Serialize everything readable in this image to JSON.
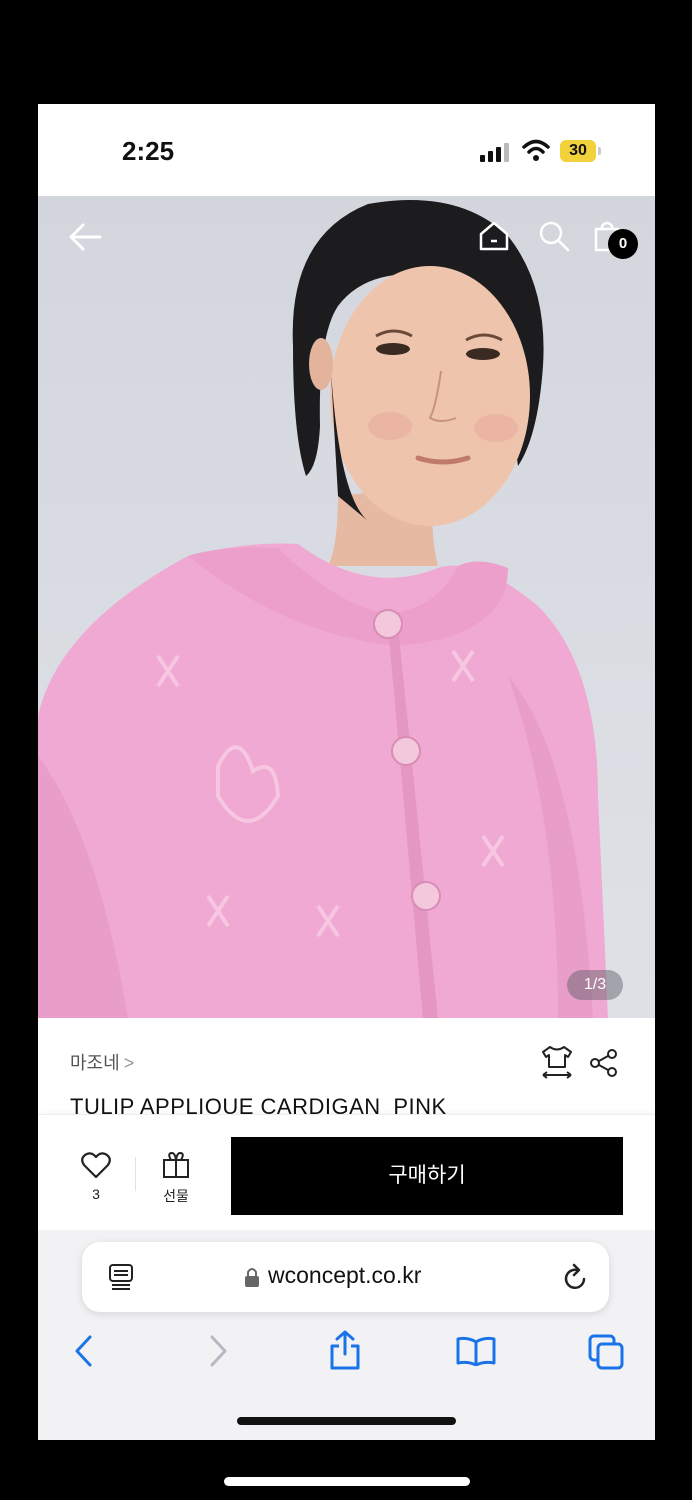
{
  "status_bar": {
    "time": "2:25",
    "battery": "30",
    "battery_color": "#f2d23a"
  },
  "product_nav": {
    "back_icon": "arrow-left-icon",
    "home_icon": "home-icon",
    "search_icon": "search-icon",
    "cart_icon": "shopping-bag-icon",
    "cart_count": "0"
  },
  "gallery": {
    "counter": "1/3"
  },
  "product": {
    "brand": "마조네",
    "brand_chevron": ">",
    "name": "TULIP APPLIQUE CARDIGAN_PINK",
    "size_icon": "size-guide-icon",
    "share_icon": "share-icon"
  },
  "action_bar": {
    "like_icon": "heart-icon",
    "like_count": "3",
    "gift_icon": "gift-icon",
    "gift_label": "선물",
    "buy_label": "구매하기",
    "buy_color": "#000000"
  },
  "browser": {
    "url": "wconcept.co.kr",
    "reader_icon": "reader-icon",
    "lock_icon": "lock-icon",
    "reload_icon": "reload-icon",
    "toolbar": [
      "back-icon",
      "forward-icon",
      "share-icon",
      "bookmarks-icon",
      "tabs-icon"
    ],
    "accent": "#1a73e8"
  }
}
